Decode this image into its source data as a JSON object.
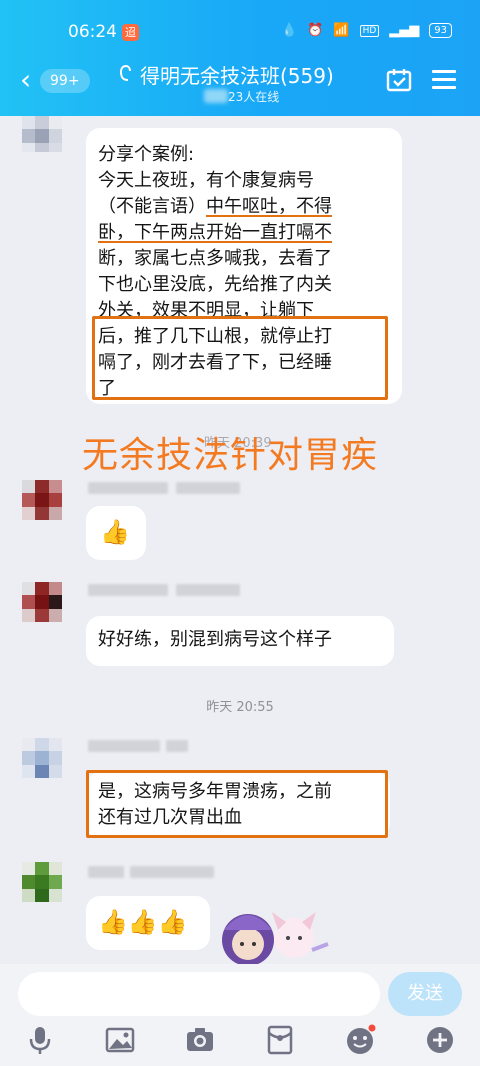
{
  "status_bar": {
    "time": "06:24",
    "notification_badge": "迢",
    "battery": "93"
  },
  "header": {
    "back_count": "99+",
    "title": "得明无余技法班(559)",
    "online_suffix": "23人在线"
  },
  "messages": [
    {
      "lines": [
        "分享个案例:",
        "今天上夜班，有个康复病号",
        "（不能言语）",
        "中午呕吐，不得",
        "卧，下午两点开始一直打嗝不",
        "断，家属七点多喊我，去看了",
        "下也心里没底，先给推了内关",
        "外关，效果不明显，让躺下",
        "后，推了几下山根，就停止打",
        "嗝了，刚才去看了下，已经睡",
        "了"
      ]
    },
    {
      "text": "👍"
    },
    {
      "text": "好好练，别混到病号这个样子"
    },
    {
      "lines": [
        "是，这病号多年胃溃疡，之前",
        "还有过几次胃出血"
      ]
    },
    {
      "text": "👍👍👍"
    }
  ],
  "overlay_caption": "无余技法针对胃疾",
  "timestamps": {
    "ghost": "昨天 20:39",
    "separator": "昨天 20:55"
  },
  "input_bar": {
    "send_label": "发送"
  },
  "colors": {
    "accent": "#1aa9f6",
    "highlight": "#e27111",
    "caption": "#f47a22"
  }
}
